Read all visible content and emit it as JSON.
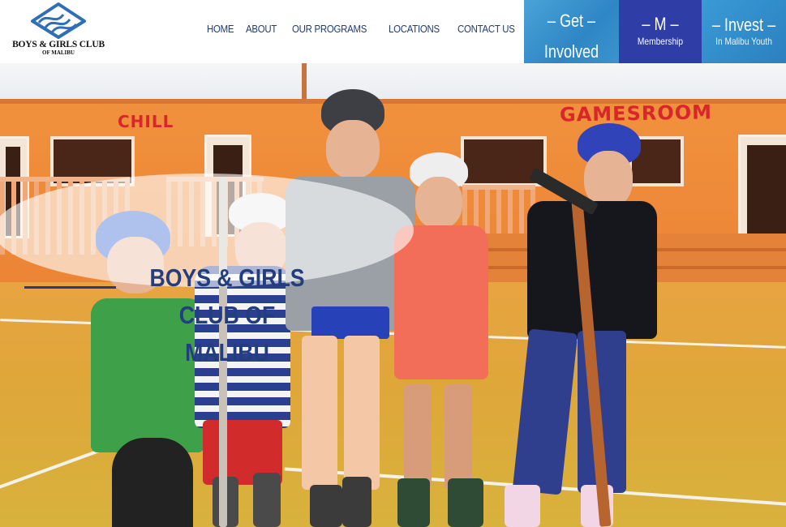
{
  "header": {
    "logo_line1": "BOYS & GIRLS CLUB",
    "logo_line2": "OF MALIBU"
  },
  "nav": {
    "items": [
      "HOME",
      "ABOUT",
      "OUR PROGRAMS",
      "LOCATIONS",
      "CONTACT US"
    ]
  },
  "cta": [
    {
      "big": "– Get –",
      "small": "Involved"
    },
    {
      "big": "– M –",
      "small": "Membership"
    },
    {
      "big": "– Invest –",
      "small": "In Malibu Youth"
    }
  ],
  "hero": {
    "title_line1": "BOYS & GIRLS",
    "title_line2": "CLUB OF MALIBU",
    "signs": [
      "CHILL",
      "GAMESROOM"
    ]
  },
  "colors": {
    "brand_navy": "#233e7e",
    "cta_blue": "#3a94cf",
    "cta_indigo": "#2f3da6"
  }
}
